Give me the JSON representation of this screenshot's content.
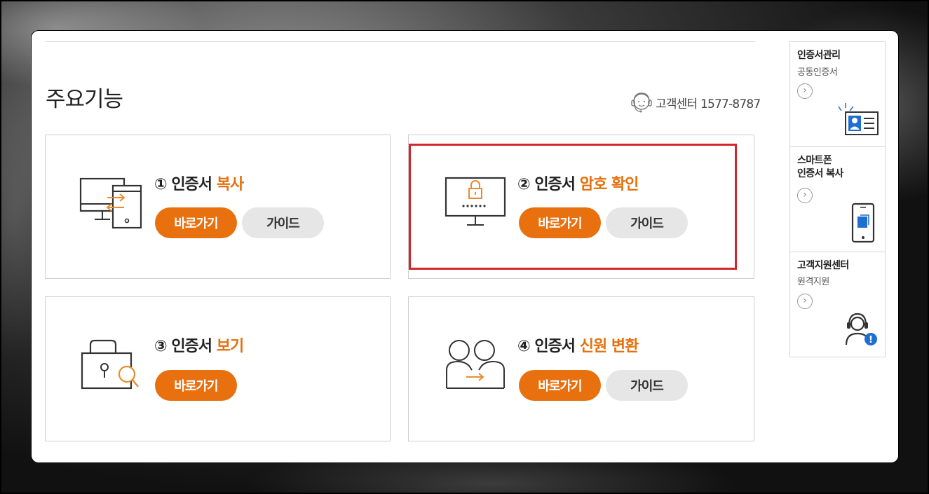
{
  "page": {
    "title": "주요기능",
    "support_text": "고객센터 1577-8787"
  },
  "cards": [
    {
      "num": "①",
      "prefix": "인증서",
      "highlight": "복사",
      "go_label": "바로가기",
      "guide_label": "가이드"
    },
    {
      "num": "②",
      "prefix": "인증서",
      "highlight": "암호 확인",
      "go_label": "바로가기",
      "guide_label": "가이드"
    },
    {
      "num": "③",
      "prefix": "인증서",
      "highlight": "보기",
      "go_label": "바로가기"
    },
    {
      "num": "④",
      "prefix": "인증서",
      "highlight": "신원 변환",
      "go_label": "바로가기",
      "guide_label": "가이드"
    }
  ],
  "sidebar": {
    "items": [
      {
        "title": "인증서관리",
        "subtitle": "공동인증서",
        "arrow": "›",
        "icon": "id-card-icon"
      },
      {
        "title": "스마트폰\n인증서 복사",
        "subtitle": "",
        "arrow": "›",
        "icon": "smartphone-icon"
      },
      {
        "title": "고객지원센터",
        "subtitle": "원격지원",
        "arrow": "›",
        "icon": "support-agent-icon"
      }
    ]
  },
  "colors": {
    "accent": "#e8700e",
    "highlight_text": "#e5700d",
    "guide_button": "#e6e6e6",
    "selection_box": "#d2262c",
    "info_badge": "#1f6fd1"
  }
}
